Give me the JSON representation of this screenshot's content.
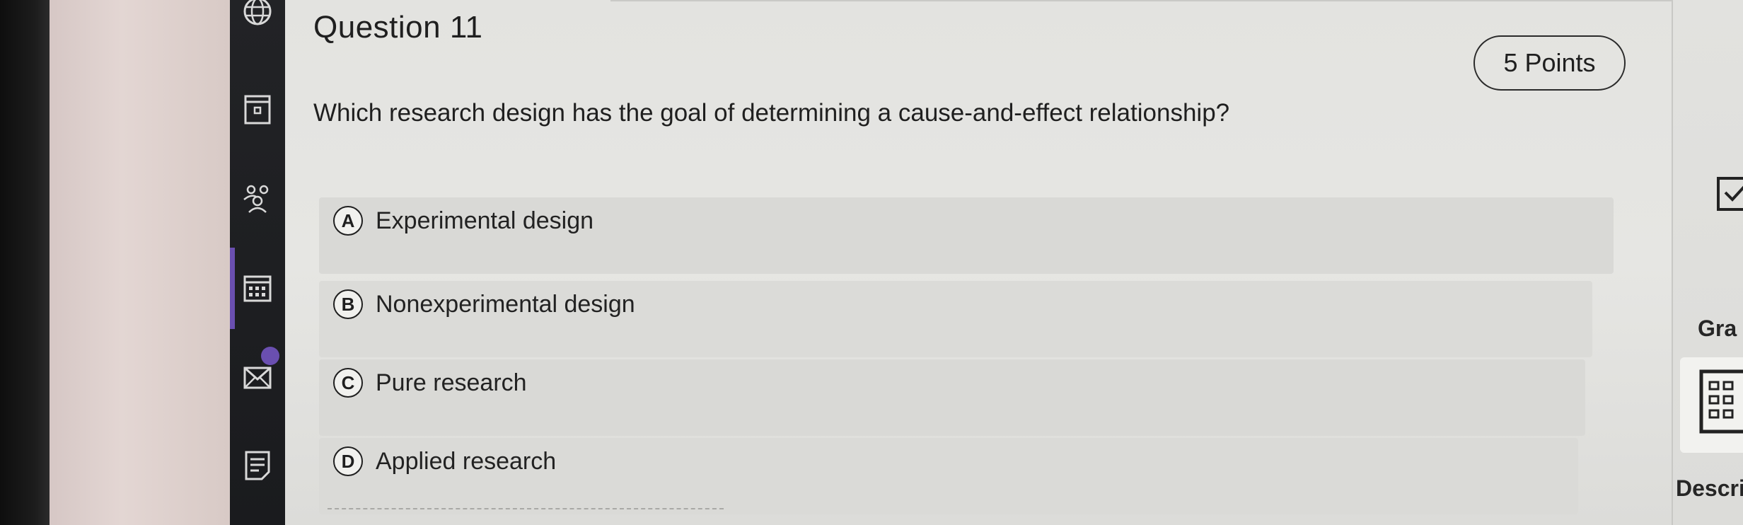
{
  "question": {
    "title": "Question 11",
    "points": "5 Points",
    "prompt": "Which research design has the goal of determining a cause-and-effect relationship?",
    "options": [
      {
        "letter": "A",
        "text": "Experimental design"
      },
      {
        "letter": "B",
        "text": "Nonexperimental design"
      },
      {
        "letter": "C",
        "text": "Pure research"
      },
      {
        "letter": "D",
        "text": "Applied research"
      }
    ]
  },
  "right_sidebar": {
    "grade_label": "Gra",
    "description_label": "Descri"
  },
  "nav_rail": {
    "icons": [
      "globe-icon",
      "course-icon",
      "people-icon",
      "calendar-icon",
      "messages-icon",
      "grades-icon"
    ]
  },
  "colors": {
    "rail_accent": "#6a4fb0",
    "panel_bg": "#e4e4e1",
    "option_bg": "#d9d9d6"
  }
}
